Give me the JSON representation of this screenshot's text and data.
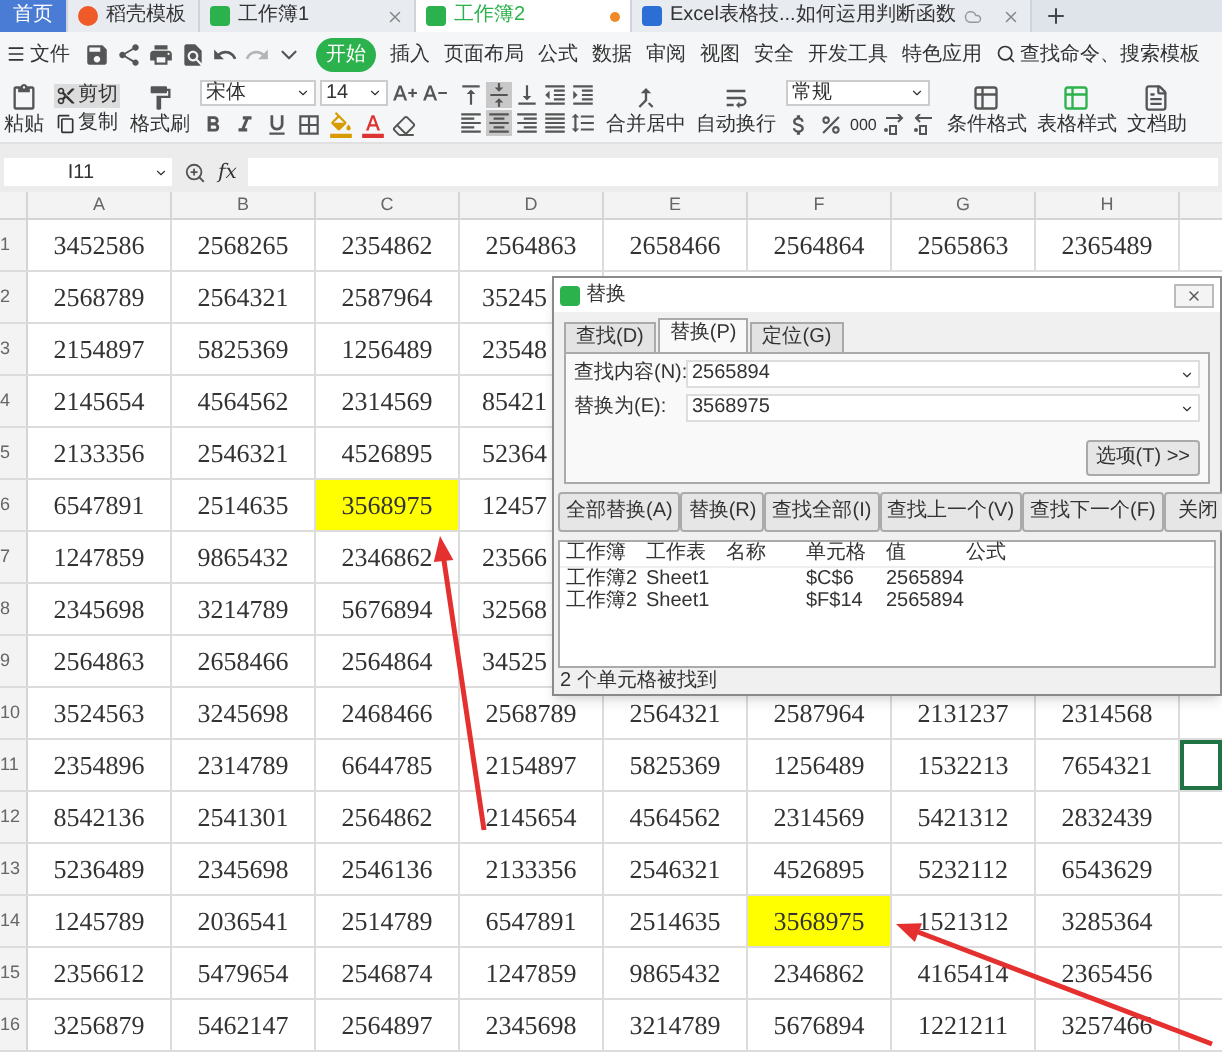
{
  "tabs": [
    {
      "kind": "home",
      "label": "首页",
      "selected": false
    },
    {
      "kind": "template",
      "label": "稻壳模板",
      "selected": false
    },
    {
      "kind": "sheet",
      "label": "工作簿1",
      "selected": false,
      "modified": false
    },
    {
      "kind": "sheet",
      "label": "工作簿2",
      "selected": true,
      "modified": true
    },
    {
      "kind": "document",
      "label": "Excel表格技...如何运用判断函数",
      "selected": false,
      "modified": false
    }
  ],
  "menu": {
    "file": "文件",
    "items": [
      {
        "label": "开始",
        "selected": true
      },
      {
        "label": "插入",
        "selected": false
      },
      {
        "label": "页面布局",
        "selected": false
      },
      {
        "label": "公式",
        "selected": false
      },
      {
        "label": "数据",
        "selected": false
      },
      {
        "label": "审阅",
        "selected": false
      },
      {
        "label": "视图",
        "selected": false
      },
      {
        "label": "安全",
        "selected": false
      },
      {
        "label": "开发工具",
        "selected": false
      },
      {
        "label": "特色应用",
        "selected": false
      }
    ],
    "search": "查找命令、搜索模板"
  },
  "toolbar": {
    "paste": "粘贴",
    "clipboard": [
      {
        "kind": "cut",
        "label": "剪切",
        "highlighted": true
      },
      {
        "kind": "copy",
        "label": "复制",
        "highlighted": false
      }
    ],
    "format_painter": "格式刷",
    "font": "宋体",
    "font_size": "14",
    "alignment": [
      {
        "kind": "top",
        "selected": false
      },
      {
        "kind": "middle",
        "selected": true
      },
      {
        "kind": "bottom",
        "selected": false
      },
      {
        "kind": "outdent",
        "selected": false
      },
      {
        "kind": "indent",
        "selected": false
      },
      {
        "kind": "left",
        "selected": false
      },
      {
        "kind": "center",
        "selected": true
      },
      {
        "kind": "right",
        "selected": false
      },
      {
        "kind": "justify",
        "selected": false
      },
      {
        "kind": "distributed",
        "selected": false
      }
    ],
    "merge": "合并居中",
    "wrap": "自动换行",
    "number_format": "常规",
    "thousands": "000",
    "conditional": "条件格式",
    "table_style": "表格样式",
    "assistant": "文档助"
  },
  "formula_bar": {
    "name_box": "I11",
    "fx": "fx"
  },
  "grid": {
    "columns": [
      "A",
      "B",
      "C",
      "D",
      "E",
      "F",
      "G",
      "H"
    ],
    "rows": [
      {
        "n": "1",
        "cursor": false,
        "cells": [
          "3452586",
          "2568265",
          "2354862",
          "2564863",
          "2658466",
          "2564864",
          "2565863",
          "2365489"
        ]
      },
      {
        "n": "2",
        "cursor": false,
        "cells": [
          "2568789",
          "2564321",
          "2587964",
          "35245"
        ]
      },
      {
        "n": "3",
        "cells": [
          "2154897",
          "5825369",
          "1256489",
          "23548"
        ]
      },
      {
        "n": "4",
        "cells": [
          "2145654",
          "4564562",
          "2314569",
          "85421"
        ]
      },
      {
        "n": "5",
        "cells": [
          "2133356",
          "2546321",
          "4526895",
          "52364"
        ]
      },
      {
        "n": "6",
        "cells": [
          "6547891",
          "2514635",
          {
            "text": "3568975",
            "color": "#ffff00"
          },
          "12457"
        ]
      },
      {
        "n": "7",
        "cells": [
          "1247859",
          "9865432",
          "2346862",
          "23566"
        ]
      },
      {
        "n": "8",
        "cells": [
          "2345698",
          "3214789",
          "5676894",
          "32568"
        ]
      },
      {
        "n": "9",
        "cells": [
          "2564863",
          "2658466",
          "2564864",
          "34525"
        ]
      },
      {
        "n": "10",
        "cursor": false,
        "cells": [
          "3524563",
          "3245698",
          "2468466",
          "2568789",
          "2564321",
          "2587964",
          "2131237",
          "2314568"
        ]
      },
      {
        "n": "11",
        "cursor": true,
        "cells": [
          "2354896",
          "2314789",
          "6644785",
          "2154897",
          "5825369",
          "1256489",
          "1532213",
          "7654321"
        ]
      },
      {
        "n": "12",
        "cursor": false,
        "cells": [
          "8542136",
          "2541301",
          "2564862",
          "2145654",
          "4564562",
          "2314569",
          "5421312",
          "2832439"
        ]
      },
      {
        "n": "13",
        "cursor": false,
        "cells": [
          "5236489",
          "2345698",
          "2546136",
          "2133356",
          "2546321",
          "4526895",
          "5232112",
          "6543629"
        ]
      },
      {
        "n": "14",
        "cursor": false,
        "cells": [
          "1245789",
          "2036541",
          "2514789",
          "6547891",
          "2514635",
          {
            "text": "3568975",
            "color": "#ffff00"
          },
          "1521312",
          "3285364"
        ]
      },
      {
        "n": "15",
        "cursor": false,
        "cells": [
          "2356612",
          "5479654",
          "2546874",
          "1247859",
          "9865432",
          "2346862",
          "4165414",
          "2365456"
        ]
      },
      {
        "n": "16",
        "cursor": false,
        "cells": [
          "3256879",
          "5462147",
          "2564897",
          "2345698",
          "3214789",
          "5676894",
          "1221211",
          "3257466"
        ]
      }
    ]
  },
  "dialog": {
    "title": "替换",
    "tabs": [
      {
        "label": "查找(D)",
        "selected": false
      },
      {
        "label": "替换(P)",
        "selected": true
      },
      {
        "label": "定位(G)",
        "selected": false
      }
    ],
    "fields": [
      {
        "label": "查找内容(N):",
        "value": "2565894"
      },
      {
        "label": "替换为(E):",
        "value": "3568975"
      }
    ],
    "options": "选项(T) >>",
    "buttons": [
      {
        "label": "全部替换(A)"
      },
      {
        "label": "替换(R)"
      },
      {
        "label": "查找全部(I)"
      },
      {
        "label": "查找上一个(V)"
      },
      {
        "label": "查找下一个(F)"
      },
      {
        "label": "关闭"
      }
    ],
    "results": {
      "columns": [
        {
          "label": "工作簿"
        },
        {
          "label": "工作表"
        },
        {
          "label": "名称"
        },
        {
          "label": "单元格"
        },
        {
          "label": "值"
        },
        {
          "label": "公式"
        }
      ],
      "rows": [
        {
          "workbook": "工作簿2",
          "sheet": "Sheet1",
          "cell": "$C$6",
          "value": "2565894"
        },
        {
          "workbook": "工作簿2",
          "sheet": "Sheet1",
          "cell": "$F$14",
          "value": "2565894"
        }
      ]
    },
    "status": "2 个单元格被找到"
  }
}
